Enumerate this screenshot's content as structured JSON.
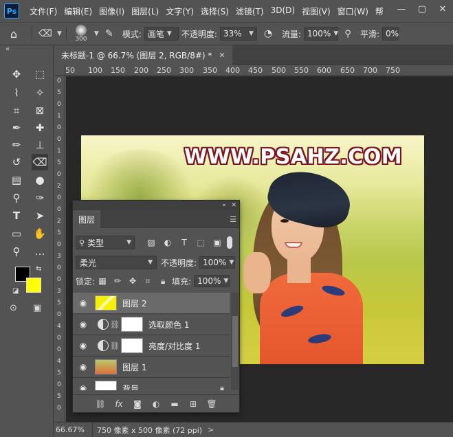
{
  "app": {
    "logo": "Ps"
  },
  "menu": [
    "文件(F)",
    "编辑(E)",
    "图像(I)",
    "图层(L)",
    "文字(Y)",
    "选择(S)",
    "滤镜(T)",
    "3D(D)",
    "视图(V)",
    "窗口(W)",
    "帮"
  ],
  "window_controls": [
    "—",
    "▢",
    "✕"
  ],
  "options": {
    "brush_size": "300",
    "mode_label": "模式:",
    "mode_value": "画笔",
    "opacity_label": "不透明度:",
    "opacity_value": "33%",
    "flow_label": "流量:",
    "flow_value": "100%",
    "smooth_label": "平滑:",
    "smooth_value": "0%"
  },
  "document": {
    "tab_title": "未标题-1 @ 66.7% (图层 2, RGB/8#) *",
    "ruler_h": [
      "50",
      "100",
      "150",
      "200",
      "250",
      "300",
      "350",
      "400",
      "450",
      "500",
      "550",
      "600",
      "650",
      "700",
      "750"
    ],
    "ruler_v": [
      "0",
      "5",
      "0",
      "1",
      "0",
      "0",
      "1",
      "5",
      "0",
      "2",
      "0",
      "0",
      "2",
      "5",
      "0",
      "3",
      "0",
      "0",
      "3",
      "5",
      "0",
      "4",
      "0",
      "0",
      "4",
      "5",
      "0",
      "5",
      "0"
    ],
    "watermark": "WWW.PSAHZ.COM"
  },
  "status": {
    "zoom": "66.67%",
    "info": "750 像素 x 500 像素 (72 ppi)",
    "arrow": ">"
  },
  "layers_panel": {
    "tab": "图层",
    "filter_label": "类型",
    "blend_mode": "柔光",
    "opacity_label": "不透明度:",
    "opacity_value": "100%",
    "lock_label": "锁定:",
    "fill_label": "填充:",
    "fill_value": "100%",
    "layers": [
      {
        "name": "图层 2"
      },
      {
        "name": "选取颜色 1"
      },
      {
        "name": "亮度/对比度 1"
      },
      {
        "name": "图层 1"
      },
      {
        "name": "背景"
      }
    ]
  },
  "colors": {
    "foreground": "#000000",
    "background": "#ffff00",
    "watermark_outline": "#7a1620"
  }
}
